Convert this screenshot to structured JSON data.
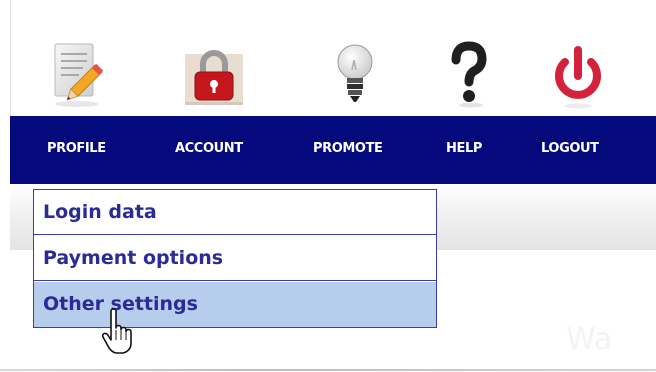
{
  "nav": {
    "items": [
      {
        "label": "PROFILE",
        "icon": "notepad-pencil-icon"
      },
      {
        "label": "ACCOUNT",
        "icon": "padlock-icon"
      },
      {
        "label": "PROMOTE",
        "icon": "lightbulb-icon"
      },
      {
        "label": "HELP",
        "icon": "question-mark-icon"
      },
      {
        "label": "LOGOUT",
        "icon": "power-icon"
      }
    ],
    "background_color": "#040a7c",
    "text_color": "#ffffff"
  },
  "dropdown": {
    "parent": "ACCOUNT",
    "items": [
      {
        "label": "Login data"
      },
      {
        "label": "Payment options"
      },
      {
        "label": "Other settings",
        "hovered": true
      }
    ],
    "text_color": "#2b2b96",
    "hover_color": "#b6cdec"
  },
  "cursor": {
    "icon": "hand-pointer-cursor-icon"
  }
}
